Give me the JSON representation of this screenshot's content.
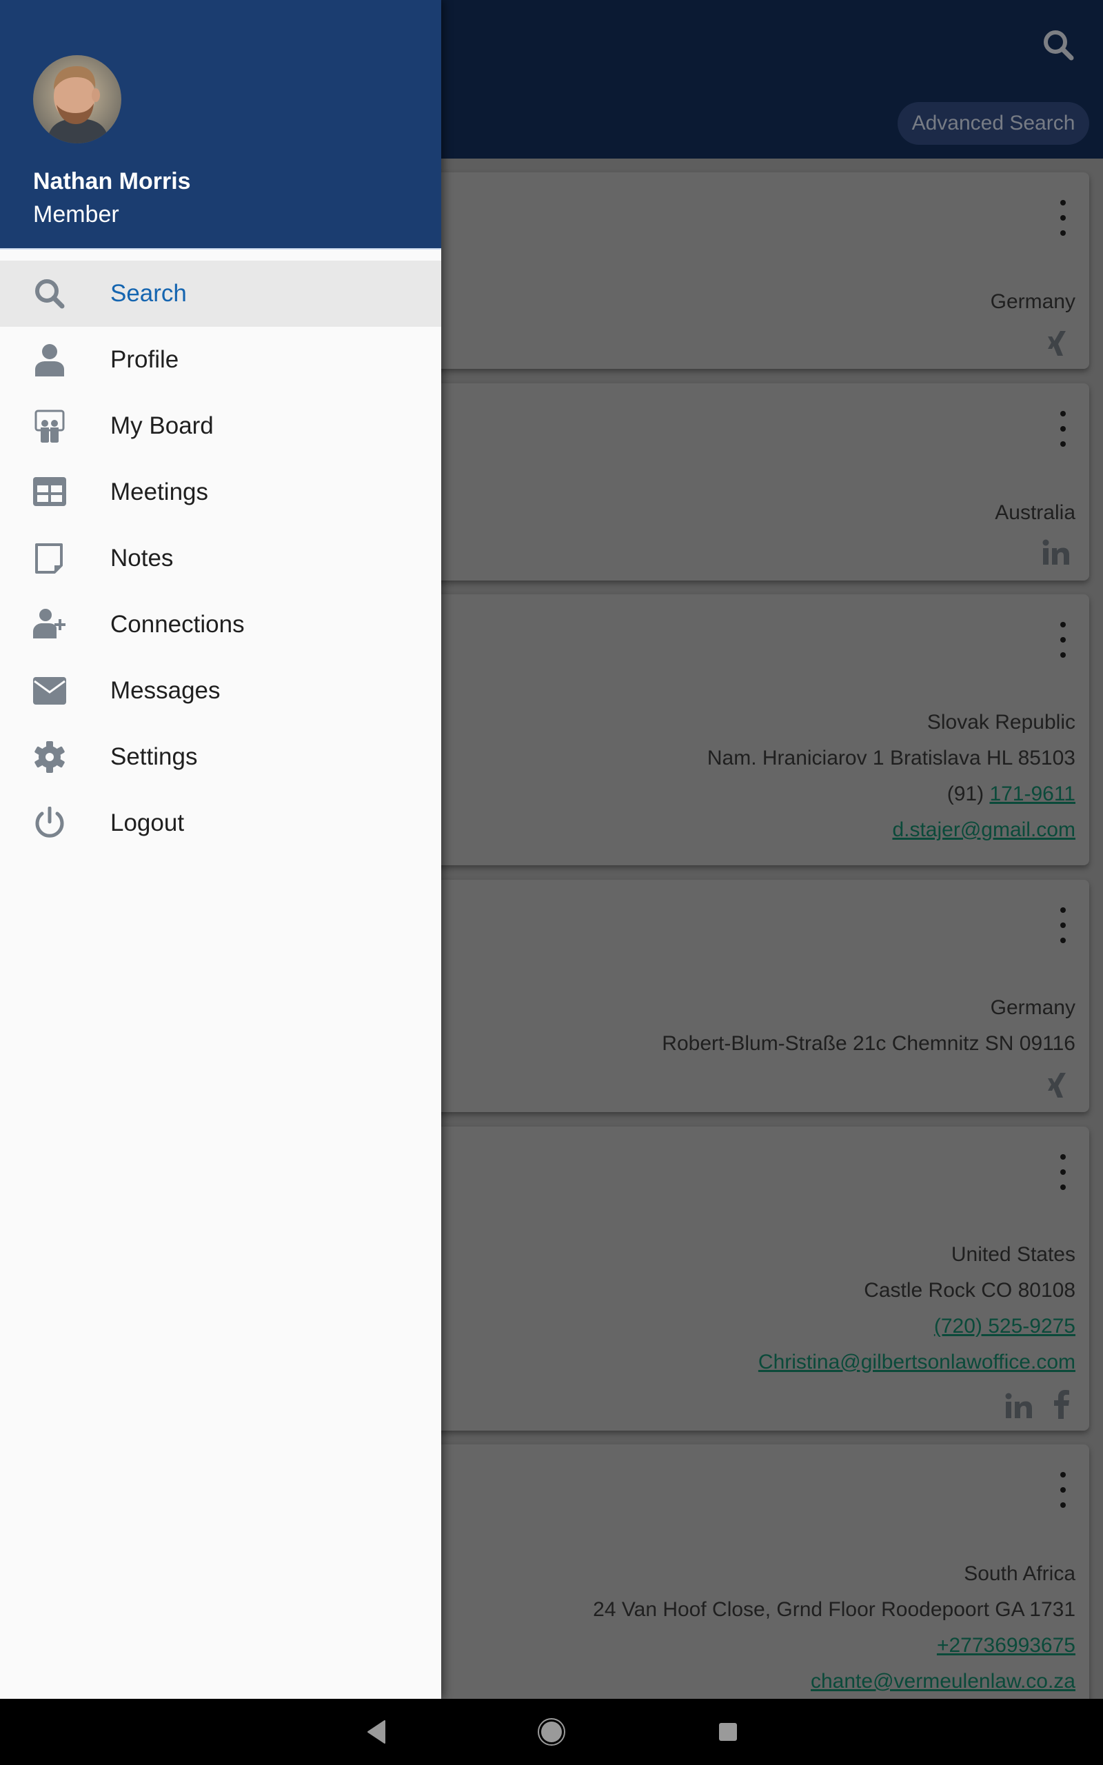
{
  "topbar": {
    "search_icon": "search-icon",
    "advanced_search_label": "Advanced Search"
  },
  "cards": [
    {
      "country": "Germany",
      "address": null,
      "phone_prefix": null,
      "phone": null,
      "email": null,
      "socials": [
        "xing"
      ]
    },
    {
      "country": "Australia",
      "address": null,
      "phone_prefix": null,
      "phone": null,
      "email": null,
      "socials": [
        "linkedin"
      ]
    },
    {
      "country": "Slovak Republic",
      "address": "Nam. Hraniciarov 1 Bratislava HL 85103",
      "phone_prefix": "(91) ",
      "phone": "171-9611",
      "email": "d.stajer@gmail.com",
      "socials": []
    },
    {
      "country": "Germany",
      "address": "Robert-Blum-Straße 21c Chemnitz SN 09116",
      "phone_prefix": null,
      "phone": null,
      "email": null,
      "socials": [
        "xing"
      ]
    },
    {
      "country": "United States",
      "address": "Castle Rock CO 80108",
      "phone_prefix": null,
      "phone": "(720) 525-9275",
      "email": "Christina@gilbertsonlawoffice.com",
      "socials": [
        "linkedin",
        "facebook"
      ]
    },
    {
      "country": "South Africa",
      "address": "24 Van Hoof Close, Grnd Floor Roodepoort GA 1731",
      "phone_prefix": null,
      "phone": "+27736993675",
      "email": "chante@vermeulenlaw.co.za",
      "socials": []
    }
  ],
  "drawer": {
    "user": {
      "name": "Nathan Morris",
      "role": "Member"
    },
    "items": [
      {
        "label": "Search",
        "icon": "search-icon",
        "selected": true
      },
      {
        "label": "Profile",
        "icon": "person-icon",
        "selected": false
      },
      {
        "label": "My Board",
        "icon": "board-icon",
        "selected": false
      },
      {
        "label": "Meetings",
        "icon": "table-grid-icon",
        "selected": false
      },
      {
        "label": "Notes",
        "icon": "note-icon",
        "selected": false
      },
      {
        "label": "Connections",
        "icon": "add-person-icon",
        "selected": false
      },
      {
        "label": "Messages",
        "icon": "envelope-icon",
        "selected": false
      },
      {
        "label": "Settings",
        "icon": "gear-icon",
        "selected": false
      },
      {
        "label": "Logout",
        "icon": "power-icon",
        "selected": false
      }
    ]
  },
  "colors": {
    "drawer_header": "#1b3d70",
    "selected_text": "#1565b0",
    "selected_bg": "#e8e8e8",
    "icon_gray": "#7a838d",
    "link_green": "#0b4a3a"
  },
  "navbar": {
    "back": "back-icon",
    "home": "home-icon",
    "recents": "recents-icon"
  }
}
